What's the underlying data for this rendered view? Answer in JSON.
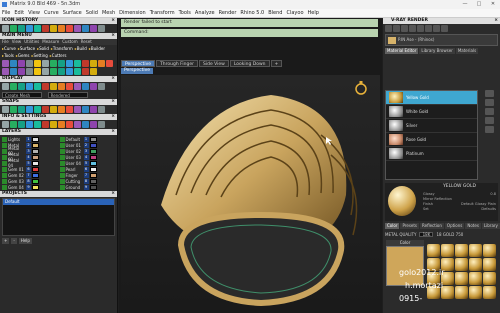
{
  "window": {
    "title": "Matrix 9.0 Bld 469 - 5n.3dm"
  },
  "menu": [
    "File",
    "Edit",
    "View",
    "Curve",
    "Surface",
    "Solid",
    "Mesh",
    "Dimension",
    "Transform",
    "Tools",
    "Analyze",
    "Render",
    "Rhino 5.0",
    "Blend",
    "Clayoo",
    "Help"
  ],
  "left": {
    "icon_history": "ICON HISTORY",
    "main_menu": "MAIN MENU",
    "submenu": [
      "File",
      "View",
      "Utilities",
      "Measure",
      "Custom",
      "Reset"
    ],
    "categories": [
      "Curve",
      "Surface",
      "Solid",
      "Transform",
      "Build",
      "Builder",
      "Tools",
      "Gems",
      "Setting",
      "Cutters"
    ],
    "display": "DISPLAY",
    "display_mode": "Create Mesh",
    "display_mode2": "Rendered",
    "snaps": "SNAPS",
    "info": "INFO & SETTINGS",
    "layers_title": "LAYERS",
    "layers_left": [
      "Lights",
      "Metal",
      "Metal 02",
      "Metal 03",
      "Metal 04",
      "Gem 01",
      "Gem 02",
      "Gem 03",
      "Gem 04"
    ],
    "layers_right": [
      "Default",
      "User 01",
      "User 02",
      "User 03",
      "User 04",
      "Pearl",
      "Finger",
      "Cutting",
      "Ground"
    ],
    "projects": "PROJECTS",
    "project_selected": "Default",
    "project_buttons": [
      "+",
      "-",
      "Help"
    ]
  },
  "center": {
    "command_status": "Render failed to start",
    "command_label": "Command:",
    "tabs": [
      "Perspective",
      "Through Finger",
      "Side View",
      "Looking Down",
      "+"
    ],
    "viewport_label": "Perspective"
  },
  "right": {
    "title": "V-RAY RENDER",
    "asset": "P.IN Ase - (Rhinos)",
    "tabs": [
      "Material Editor",
      "Library Browser",
      "Materials"
    ],
    "materials": [
      "Yellow Gold",
      "White Gold",
      "Silver",
      "Rose Gold",
      "Platinum"
    ],
    "selected_material": "YELLOW GOLD",
    "preview_rows": [
      [
        "Glossy",
        "0.8"
      ],
      [
        "Mirror Reflection",
        ""
      ],
      [
        "Finish",
        "Default Glossy Plain"
      ],
      [
        "Set",
        "Defaults"
      ]
    ],
    "color_tabs": [
      "Color",
      "Presets",
      "Reflection",
      "Options",
      "Notes",
      "Library"
    ],
    "metal_quality_label": "METAL QUALITY",
    "metal_quality": "18K",
    "metal_karat": "18 GOLD 750",
    "color_label": "Color"
  },
  "overlay": {
    "line1": "golo2012.ir",
    "line2": "h.mortazi",
    "line3": "0915-"
  },
  "colors": {
    "accent_blue": "#4d7bb5",
    "cmd_green": "#b9d3b0",
    "gold": "#cfa65a",
    "selected_material": "#3fa7d0"
  }
}
